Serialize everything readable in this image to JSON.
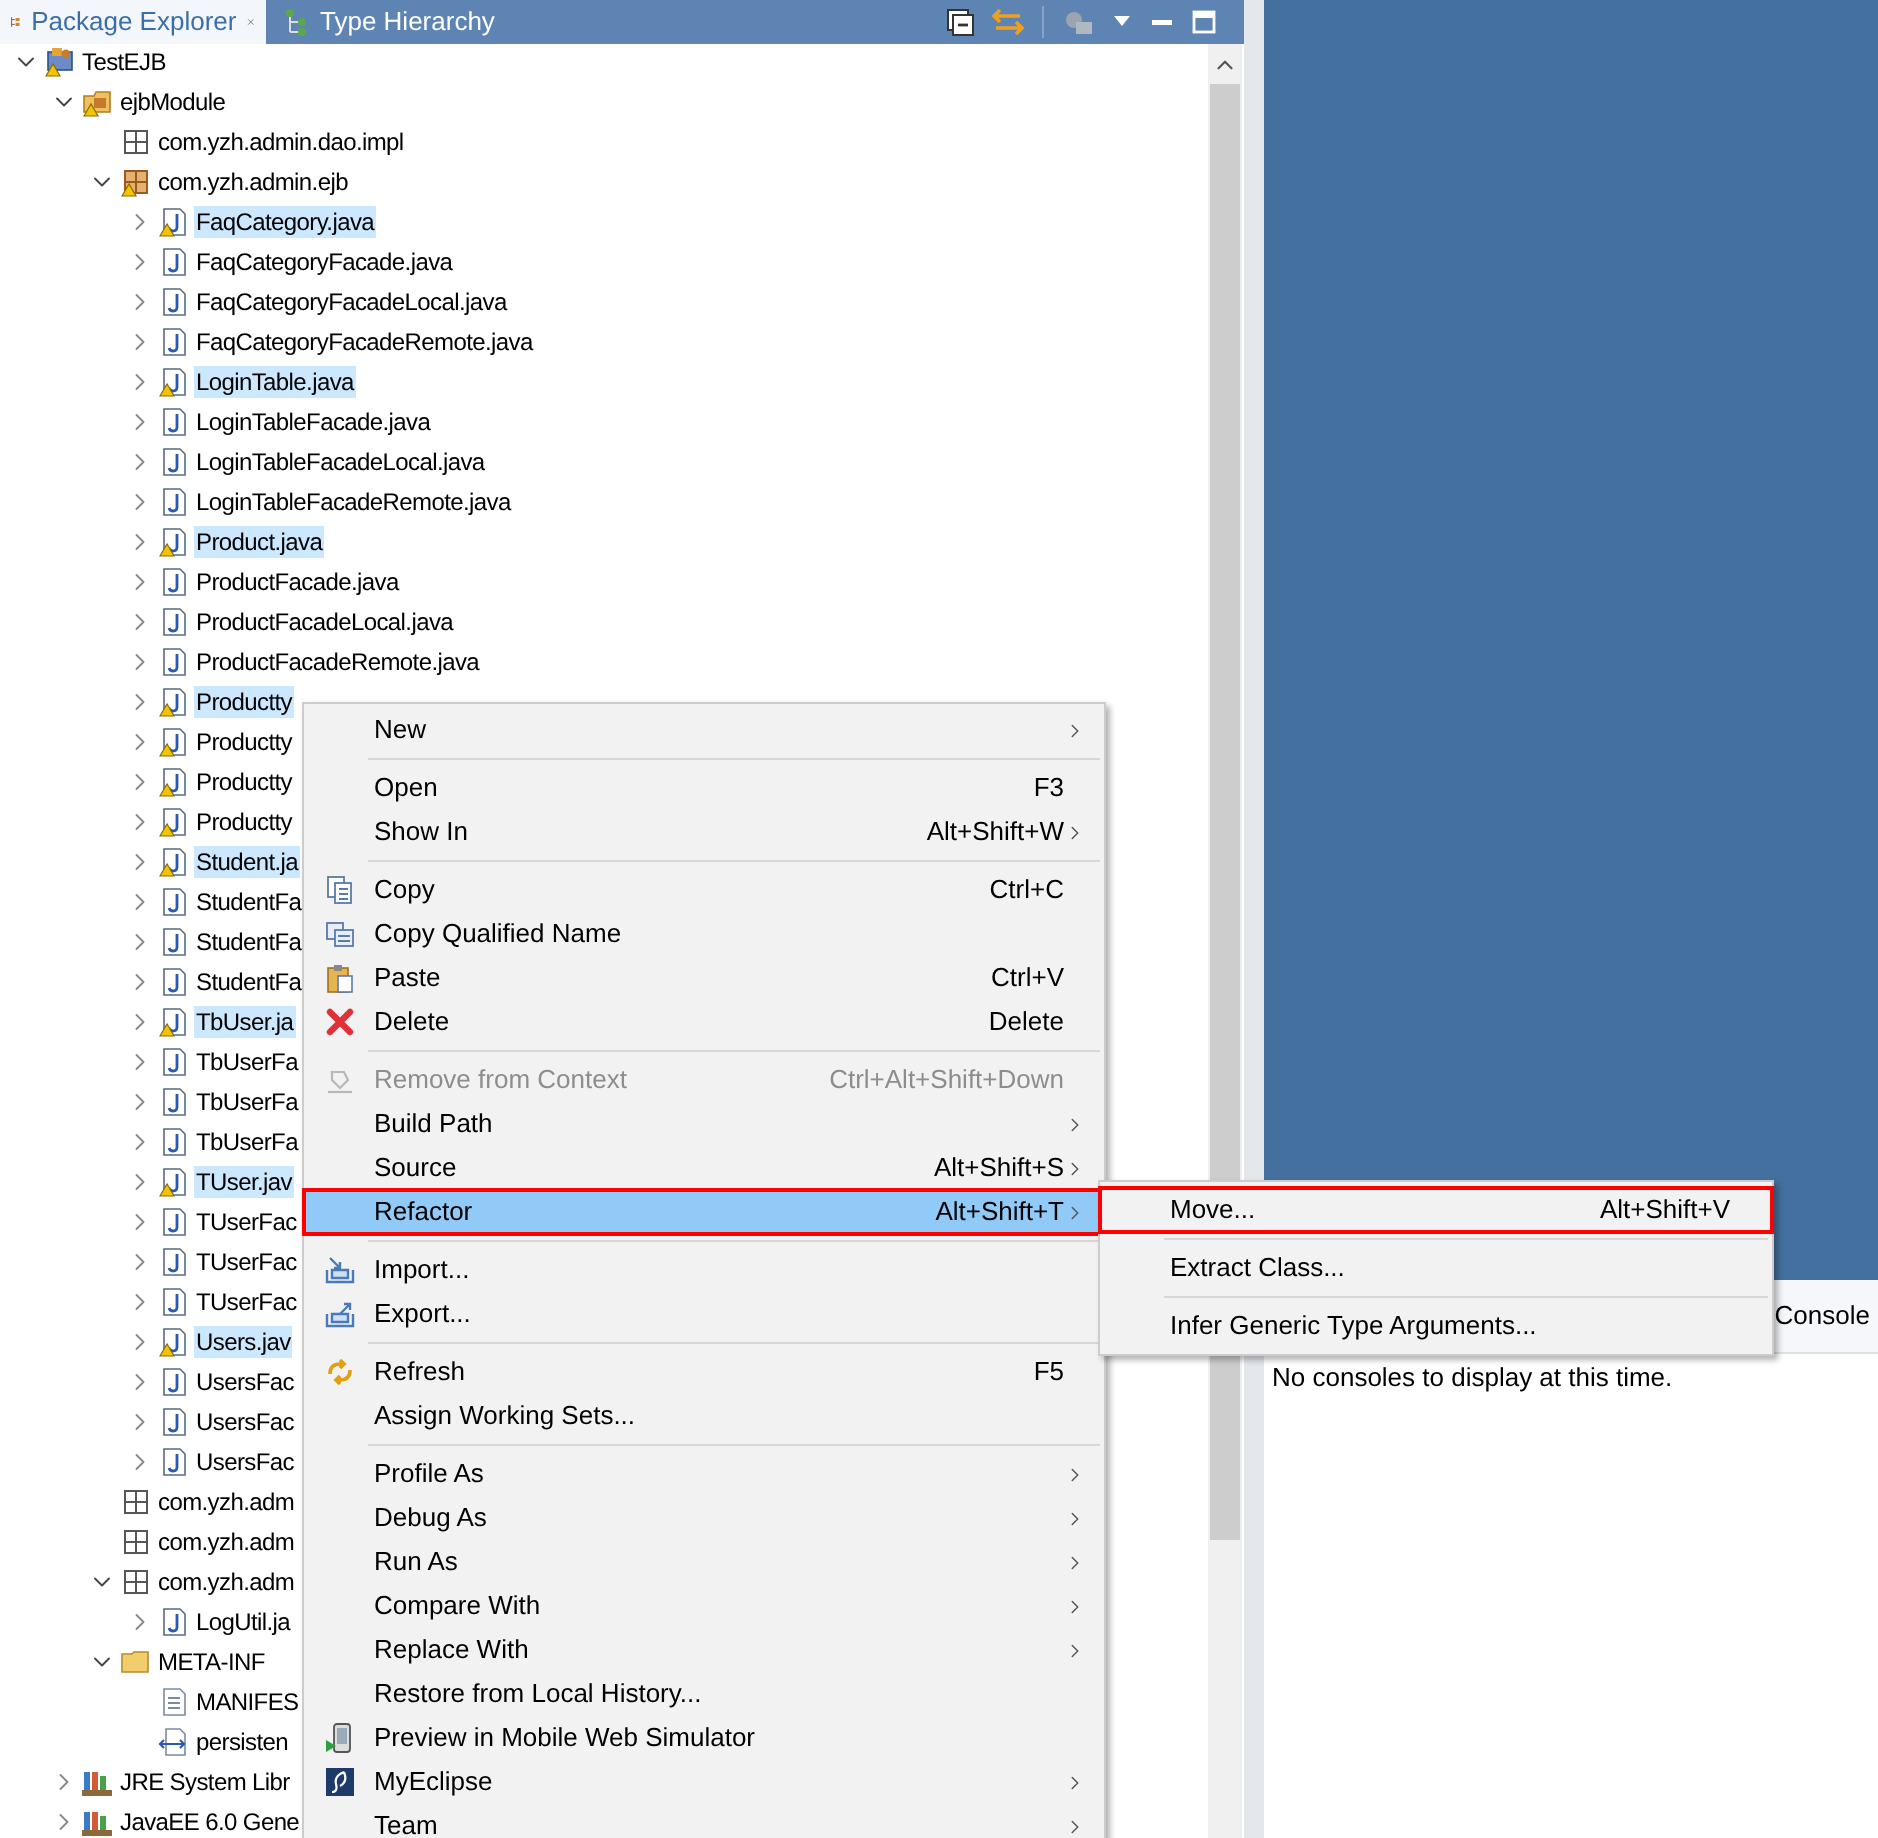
{
  "tabs": [
    {
      "label": "Package Explorer",
      "selected": true
    },
    {
      "label": "Type Hierarchy",
      "selected": false
    }
  ],
  "tree": [
    {
      "label": "TestEJB",
      "kind": "project",
      "warning": true,
      "selected": false,
      "expanded": true,
      "children": [
        {
          "label": "ejbModule",
          "kind": "source-folder",
          "warning": true,
          "selected": false,
          "expanded": true,
          "children": [
            {
              "label": "com.yzh.admin.dao.impl",
              "kind": "package",
              "warning": false,
              "selected": false
            },
            {
              "label": "com.yzh.admin.ejb",
              "kind": "package",
              "warning": true,
              "selected": false,
              "expanded": true,
              "children": [
                {
                  "label": "FaqCategory.java",
                  "kind": "java",
                  "warning": true,
                  "selected": true,
                  "expanded": false
                },
                {
                  "label": "FaqCategoryFacade.java",
                  "kind": "java",
                  "warning": false,
                  "selected": false,
                  "expanded": false
                },
                {
                  "label": "FaqCategoryFacadeLocal.java",
                  "kind": "java",
                  "warning": false,
                  "selected": false,
                  "expanded": false
                },
                {
                  "label": "FaqCategoryFacadeRemote.java",
                  "kind": "java",
                  "warning": false,
                  "selected": false,
                  "expanded": false
                },
                {
                  "label": "LoginTable.java",
                  "kind": "java",
                  "warning": true,
                  "selected": true,
                  "expanded": false
                },
                {
                  "label": "LoginTableFacade.java",
                  "kind": "java",
                  "warning": false,
                  "selected": false,
                  "expanded": false
                },
                {
                  "label": "LoginTableFacadeLocal.java",
                  "kind": "java",
                  "warning": false,
                  "selected": false,
                  "expanded": false
                },
                {
                  "label": "LoginTableFacadeRemote.java",
                  "kind": "java",
                  "warning": false,
                  "selected": false,
                  "expanded": false
                },
                {
                  "label": "Product.java",
                  "kind": "java",
                  "warning": true,
                  "selected": true,
                  "expanded": false
                },
                {
                  "label": "ProductFacade.java",
                  "kind": "java",
                  "warning": false,
                  "selected": false,
                  "expanded": false
                },
                {
                  "label": "ProductFacadeLocal.java",
                  "kind": "java",
                  "warning": false,
                  "selected": false,
                  "expanded": false
                },
                {
                  "label": "ProductFacadeRemote.java",
                  "kind": "java",
                  "warning": false,
                  "selected": false,
                  "expanded": false
                },
                {
                  "label": "Productty",
                  "kind": "java",
                  "warning": true,
                  "selected": true,
                  "expanded": false
                },
                {
                  "label": "Productty",
                  "kind": "java",
                  "warning": true,
                  "selected": false,
                  "expanded": false
                },
                {
                  "label": "Productty",
                  "kind": "java",
                  "warning": true,
                  "selected": false,
                  "expanded": false
                },
                {
                  "label": "Productty",
                  "kind": "java",
                  "warning": true,
                  "selected": false,
                  "expanded": false
                },
                {
                  "label": "Student.ja",
                  "kind": "java",
                  "warning": true,
                  "selected": true,
                  "expanded": false
                },
                {
                  "label": "StudentFa",
                  "kind": "java",
                  "warning": false,
                  "selected": false,
                  "expanded": false
                },
                {
                  "label": "StudentFa",
                  "kind": "java",
                  "warning": false,
                  "selected": false,
                  "expanded": false
                },
                {
                  "label": "StudentFa",
                  "kind": "java",
                  "warning": false,
                  "selected": false,
                  "expanded": false
                },
                {
                  "label": "TbUser.ja",
                  "kind": "java",
                  "warning": true,
                  "selected": true,
                  "expanded": false
                },
                {
                  "label": "TbUserFa",
                  "kind": "java",
                  "warning": false,
                  "selected": false,
                  "expanded": false
                },
                {
                  "label": "TbUserFa",
                  "kind": "java",
                  "warning": false,
                  "selected": false,
                  "expanded": false
                },
                {
                  "label": "TbUserFa",
                  "kind": "java",
                  "warning": false,
                  "selected": false,
                  "expanded": false
                },
                {
                  "label": "TUser.jav",
                  "kind": "java",
                  "warning": true,
                  "selected": true,
                  "expanded": false
                },
                {
                  "label": "TUserFac",
                  "kind": "java",
                  "warning": false,
                  "selected": false,
                  "expanded": false
                },
                {
                  "label": "TUserFac",
                  "kind": "java",
                  "warning": false,
                  "selected": false,
                  "expanded": false
                },
                {
                  "label": "TUserFac",
                  "kind": "java",
                  "warning": false,
                  "selected": false,
                  "expanded": false
                },
                {
                  "label": "Users.jav",
                  "kind": "java",
                  "warning": true,
                  "selected": true,
                  "expanded": false
                },
                {
                  "label": "UsersFac",
                  "kind": "java",
                  "warning": false,
                  "selected": false,
                  "expanded": false
                },
                {
                  "label": "UsersFac",
                  "kind": "java",
                  "warning": false,
                  "selected": false,
                  "expanded": false
                },
                {
                  "label": "UsersFac",
                  "kind": "java",
                  "warning": false,
                  "selected": false,
                  "expanded": false
                }
              ]
            },
            {
              "label": "com.yzh.adm",
              "kind": "package",
              "warning": false,
              "selected": false
            },
            {
              "label": "com.yzh.adm",
              "kind": "package",
              "warning": false,
              "selected": false
            },
            {
              "label": "com.yzh.adm",
              "kind": "package",
              "warning": false,
              "selected": false,
              "expanded": true,
              "children": [
                {
                  "label": "LogUtil.ja",
                  "kind": "java",
                  "warning": false,
                  "selected": false,
                  "expanded": false
                }
              ]
            },
            {
              "label": "META-INF",
              "kind": "folder",
              "warning": false,
              "selected": false,
              "expanded": true,
              "children": [
                {
                  "label": "MANIFES",
                  "kind": "text-file",
                  "warning": false,
                  "selected": false
                },
                {
                  "label": "persisten",
                  "kind": "xml-file",
                  "warning": false,
                  "selected": false
                }
              ]
            }
          ]
        },
        {
          "label": "JRE System Libr",
          "kind": "library",
          "warning": false,
          "selected": false,
          "expanded": false
        },
        {
          "label": "JavaEE 6.0 Gene",
          "kind": "library",
          "warning": false,
          "selected": false,
          "expanded": false
        }
      ]
    }
  ],
  "context_menu": {
    "items": [
      {
        "kind": "plain",
        "label": "New",
        "submenu": true,
        "disabled": false,
        "selected": false,
        "outlined": false
      },
      {
        "kind": "separator"
      },
      {
        "kind": "plain",
        "label": "Open",
        "shortcut": "F3",
        "submenu": false,
        "disabled": false,
        "selected": false,
        "outlined": false
      },
      {
        "kind": "plain",
        "label": "Show In",
        "shortcut": "Alt+Shift+W",
        "submenu": true,
        "disabled": false,
        "selected": false,
        "outlined": false
      },
      {
        "kind": "separator"
      },
      {
        "kind": "copy",
        "label": "Copy",
        "shortcut": "Ctrl+C",
        "submenu": false,
        "disabled": false,
        "selected": false,
        "outlined": false
      },
      {
        "kind": "copy-qualified",
        "label": "Copy Qualified Name",
        "submenu": false,
        "disabled": false,
        "selected": false,
        "outlined": false
      },
      {
        "kind": "paste",
        "label": "Paste",
        "shortcut": "Ctrl+V",
        "submenu": false,
        "disabled": false,
        "selected": false,
        "outlined": false
      },
      {
        "kind": "delete",
        "label": "Delete",
        "shortcut": "Delete",
        "submenu": false,
        "disabled": false,
        "selected": false,
        "outlined": false
      },
      {
        "kind": "separator"
      },
      {
        "kind": "remove",
        "label": "Remove from Context",
        "shortcut": "Ctrl+Alt+Shift+Down",
        "submenu": false,
        "disabled": true,
        "selected": false,
        "outlined": false
      },
      {
        "kind": "plain",
        "label": "Build Path",
        "submenu": true,
        "disabled": false,
        "selected": false,
        "outlined": false
      },
      {
        "kind": "plain",
        "label": "Source",
        "shortcut": "Alt+Shift+S",
        "submenu": true,
        "disabled": false,
        "selected": false,
        "outlined": false
      },
      {
        "kind": "plain",
        "label": "Refactor",
        "shortcut": "Alt+Shift+T",
        "submenu": true,
        "disabled": false,
        "selected": true,
        "outlined": true
      },
      {
        "kind": "separator"
      },
      {
        "kind": "import",
        "label": "Import...",
        "submenu": false,
        "disabled": false,
        "selected": false,
        "outlined": false
      },
      {
        "kind": "export",
        "label": "Export...",
        "submenu": false,
        "disabled": false,
        "selected": false,
        "outlined": false
      },
      {
        "kind": "separator"
      },
      {
        "kind": "refresh",
        "label": "Refresh",
        "shortcut": "F5",
        "submenu": false,
        "disabled": false,
        "selected": false,
        "outlined": false
      },
      {
        "kind": "plain",
        "label": "Assign Working Sets...",
        "submenu": false,
        "disabled": false,
        "selected": false,
        "outlined": false
      },
      {
        "kind": "separator"
      },
      {
        "kind": "plain",
        "label": "Profile As",
        "submenu": true,
        "disabled": false,
        "selected": false,
        "outlined": false
      },
      {
        "kind": "plain",
        "label": "Debug As",
        "submenu": true,
        "disabled": false,
        "selected": false,
        "outlined": false
      },
      {
        "kind": "plain",
        "label": "Run As",
        "submenu": true,
        "disabled": false,
        "selected": false,
        "outlined": false
      },
      {
        "kind": "plain",
        "label": "Compare With",
        "submenu": true,
        "disabled": false,
        "selected": false,
        "outlined": false
      },
      {
        "kind": "plain",
        "label": "Replace With",
        "submenu": true,
        "disabled": false,
        "selected": false,
        "outlined": false
      },
      {
        "kind": "plain",
        "label": "Restore from Local History...",
        "submenu": false,
        "disabled": false,
        "selected": false,
        "outlined": false
      },
      {
        "kind": "phone",
        "label": "Preview in Mobile Web Simulator",
        "submenu": false,
        "disabled": false,
        "selected": false,
        "outlined": false
      },
      {
        "kind": "myeclipse",
        "label": "MyEclipse",
        "submenu": true,
        "disabled": false,
        "selected": false,
        "outlined": false
      },
      {
        "kind": "plain",
        "label": "Team",
        "submenu": true,
        "disabled": false,
        "selected": false,
        "outlined": false
      }
    ]
  },
  "submenu": {
    "items": [
      {
        "kind": "plain",
        "label": "Move...",
        "shortcut": "Alt+Shift+V",
        "disabled": false,
        "selected": false,
        "outlined": true
      },
      {
        "kind": "separator"
      },
      {
        "kind": "plain",
        "label": "Extract Class...",
        "disabled": false,
        "selected": false,
        "outlined": false
      },
      {
        "kind": "separator"
      },
      {
        "kind": "plain",
        "label": "Infer Generic Type Arguments...",
        "disabled": false,
        "selected": false,
        "outlined": false
      }
    ]
  },
  "console": {
    "tab": "Console",
    "message": "No consoles to display at this time."
  }
}
